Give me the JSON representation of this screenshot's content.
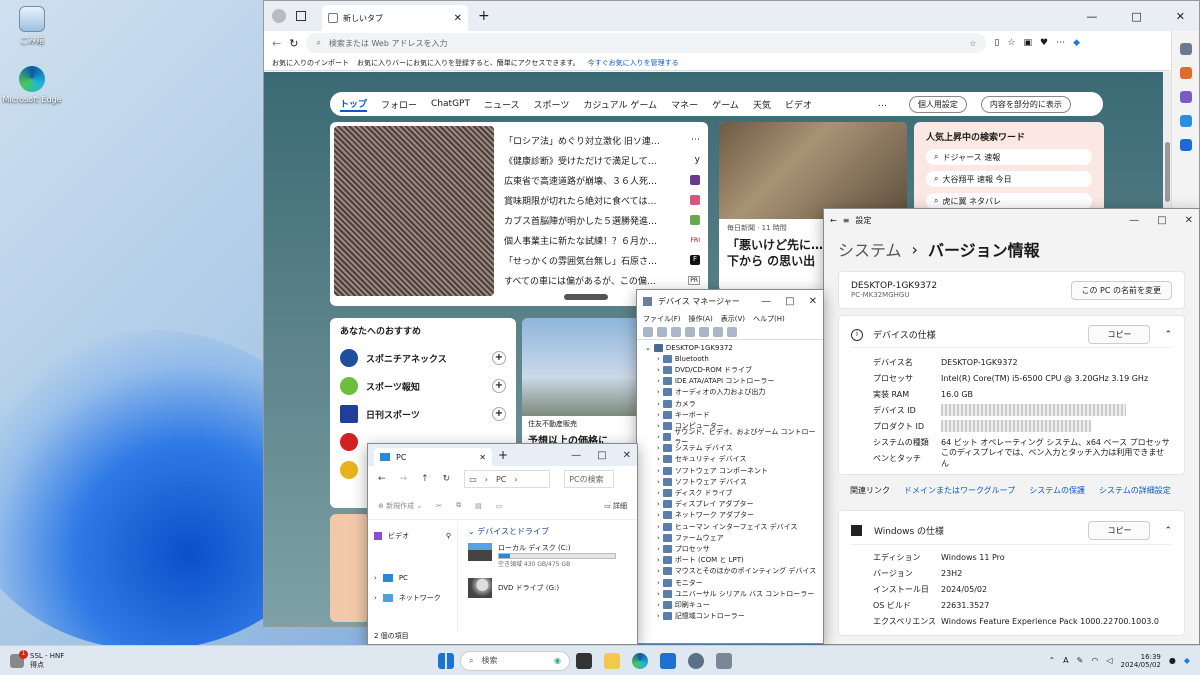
{
  "desktop": {
    "icons": [
      {
        "label": "ごみ箱"
      },
      {
        "label": "Microsoft Edge"
      }
    ]
  },
  "edge": {
    "tab_title": "新しいタブ",
    "address_placeholder": "検索または Web アドレスを入力",
    "fav_import": "お気に入りのインポート",
    "fav_message": "お気に入りバーにお気に入りを登録すると、簡単にアクセスできます。",
    "fav_link": "今すぐお気に入りを管理する",
    "nav": [
      "トップ",
      "フォロー",
      "ChatGPT",
      "ニュース",
      "スポーツ",
      "カジュアル ゲーム",
      "マネー",
      "ゲーム",
      "天気",
      "ビデオ"
    ],
    "more": "…",
    "personal_btn": "個人用設定",
    "layout_select": "内容を部分的に表示",
    "headlines": [
      "「ロシア法」めぐり対立激化 旧ソ連…",
      "《健康診断》受けただけで満足して…",
      "広東省で高速道路が崩壊、３６人死…",
      "賞味期限が切れたら絶対に食べては…",
      "カブス首脳陣が明かした５選勝発進…",
      "個人事業主に新たな試練！？６月か…",
      "「せっかくの雰囲気台無し」石原さ…",
      "すべての車には偏があるが、この偏…"
    ],
    "headline_badges": [
      "⋯",
      "y",
      "",
      "S",
      "",
      "FRI",
      "F",
      "PR"
    ],
    "feature_source": "毎日新聞 · 11 時間",
    "feature_title": "「悪いけど先に… 井 がれきの下から の思い出",
    "trending_title": "人気上昇中の検索ワード",
    "trending": [
      "ドジャース 速報",
      "大谷翔平 速報 今日",
      "虎に翼 ネタバレ"
    ],
    "recommend_title": "あなたへのおすすめ",
    "sources": [
      "スポニチアネックス",
      "スポーツ報知",
      "日刊スポーツ"
    ],
    "realestate_source": "住友不動産販売",
    "realestate_title": "予想以上の価格に"
  },
  "settings": {
    "app_title": "設定",
    "crumb_parent": "システム",
    "crumb_sep": "›",
    "crumb_current": "バージョン情報",
    "pc_name": "DESKTOP-1GK9372",
    "pc_model": "PC-MK32MGHGU",
    "rename_btn": "この PC の名前を変更",
    "device_spec_title": "デバイスの仕様",
    "copy_btn": "コピー",
    "device_specs": [
      {
        "k": "デバイス名",
        "v": "DESKTOP-1GK9372"
      },
      {
        "k": "プロセッサ",
        "v": "Intel(R) Core(TM) i5-6500 CPU @ 3.20GHz   3.19 GHz"
      },
      {
        "k": "実装 RAM",
        "v": "16.0 GB"
      },
      {
        "k": "デバイス ID",
        "v": ""
      },
      {
        "k": "プロダクト ID",
        "v": ""
      },
      {
        "k": "システムの種類",
        "v": "64 ビット オペレーティング システム、x64 ベース プロセッサ"
      },
      {
        "k": "ペンとタッチ",
        "v": "このディスプレイでは、ペン入力とタッチ入力は利用できません"
      }
    ],
    "related_label": "関連リンク",
    "related_links": [
      "ドメインまたはワークグループ",
      "システムの保護",
      "システムの詳細設定"
    ],
    "win_spec_title": "Windows の仕様",
    "win_specs": [
      {
        "k": "エディション",
        "v": "Windows 11 Pro"
      },
      {
        "k": "バージョン",
        "v": "23H2"
      },
      {
        "k": "インストール日",
        "v": "2024/05/02"
      },
      {
        "k": "OS ビルド",
        "v": "22631.3527"
      },
      {
        "k": "エクスペリエンス",
        "v": "Windows Feature Experience Pack 1000.22700.1003.0"
      }
    ]
  },
  "devmgr": {
    "title": "デバイス マネージャー",
    "menu": [
      "ファイル(F)",
      "操作(A)",
      "表示(V)",
      "ヘルプ(H)"
    ],
    "root": "DESKTOP-1GK9372",
    "nodes": [
      "Bluetooth",
      "DVD/CD-ROM ドライブ",
      "IDE ATA/ATAPI コントローラー",
      "オーディオの入力および出力",
      "カメラ",
      "キーボード",
      "コンピューター",
      "サウンド、ビデオ、およびゲーム コントローラー",
      "システム デバイス",
      "セキュリティ デバイス",
      "ソフトウェア コンポーネント",
      "ソフトウェア デバイス",
      "ディスク ドライブ",
      "ディスプレイ アダプター",
      "ネットワーク アダプター",
      "ヒューマン インターフェイス デバイス",
      "ファームウェア",
      "プロセッサ",
      "ポート (COM と LPT)",
      "マウスとそのほかのポインティング デバイス",
      "モニター",
      "ユニバーサル シリアル バス コントローラー",
      "印刷キュー",
      "記憶域コントローラー"
    ]
  },
  "explorer": {
    "tab": "PC",
    "crumb": "PC",
    "search_placeholder": "PCの検索",
    "new_btn": "新規作成",
    "details_btn": "詳細",
    "left_items": [
      "ビデオ",
      "PC",
      "ネットワーク"
    ],
    "section": "デバイスとドライブ",
    "drives": [
      {
        "name": "ローカル ディスク (C:)",
        "free": "空き領域 430 GB/475 GB",
        "used_fraction": 0.095
      },
      {
        "name": "DVD ドライブ (G:)"
      }
    ],
    "status": "2 個の項目"
  },
  "taskbar": {
    "alert_title": "SSL - HNF",
    "alert_sub": "得点",
    "alert_badge": "1",
    "search_placeholder": "検索",
    "time": "16:39",
    "date": "2024/05/02",
    "ime": "A"
  }
}
